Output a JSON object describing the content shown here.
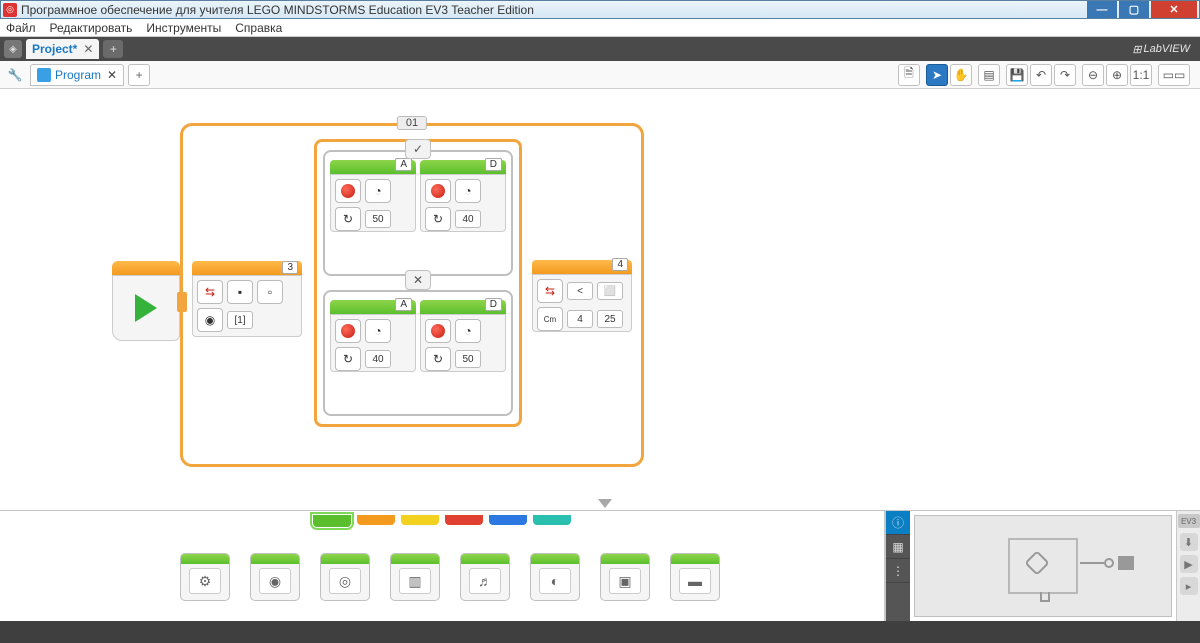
{
  "window": {
    "title": "Программное обеспечение для учителя LEGO MINDSTORMS Education EV3 Teacher Edition",
    "app_icon": "◎",
    "min": "—",
    "max": "▢",
    "close": "✕"
  },
  "menu": {
    "file": "Файл",
    "edit": "Редактировать",
    "tools": "Инструменты",
    "help": "Справка"
  },
  "project": {
    "icon": "◈",
    "name": "Project*",
    "close": "✕",
    "add": "+",
    "brand": "LabVIEW"
  },
  "program": {
    "wrench": "🔧",
    "name": "Program",
    "close": "✕",
    "add": "+"
  },
  "toolbar": {
    "doc": "🗎",
    "pointer": "➤",
    "hand": "✋",
    "comment": "▤",
    "save": "💾",
    "undo": "↶",
    "redo": "↷",
    "zoomout": "⊖",
    "zoomin": "⊕",
    "fit": "1:1",
    "book": "▭▭"
  },
  "loop": {
    "label": "01",
    "switch_true": "✓",
    "switch_false": "✕",
    "motor_a_port": "A",
    "motor_d_port": "D",
    "top_a_power": "50",
    "top_d_power": "40",
    "bot_a_power": "40",
    "bot_d_power": "50",
    "input_port": "3",
    "input_sub": "[1]",
    "end_port": "4",
    "end_op": "<",
    "end_v1": "4",
    "end_v2": "25",
    "end_unit": "⬜",
    "end_cm": "Cm"
  },
  "palette": {
    "blocks": [
      "⚙",
      "◉",
      "◎",
      "▥",
      "♬",
      "◐",
      "▣",
      "▬"
    ]
  },
  "ev3": {
    "label": "EV3",
    "dl": "⬇",
    "play": "▶",
    "plus": "▸"
  }
}
